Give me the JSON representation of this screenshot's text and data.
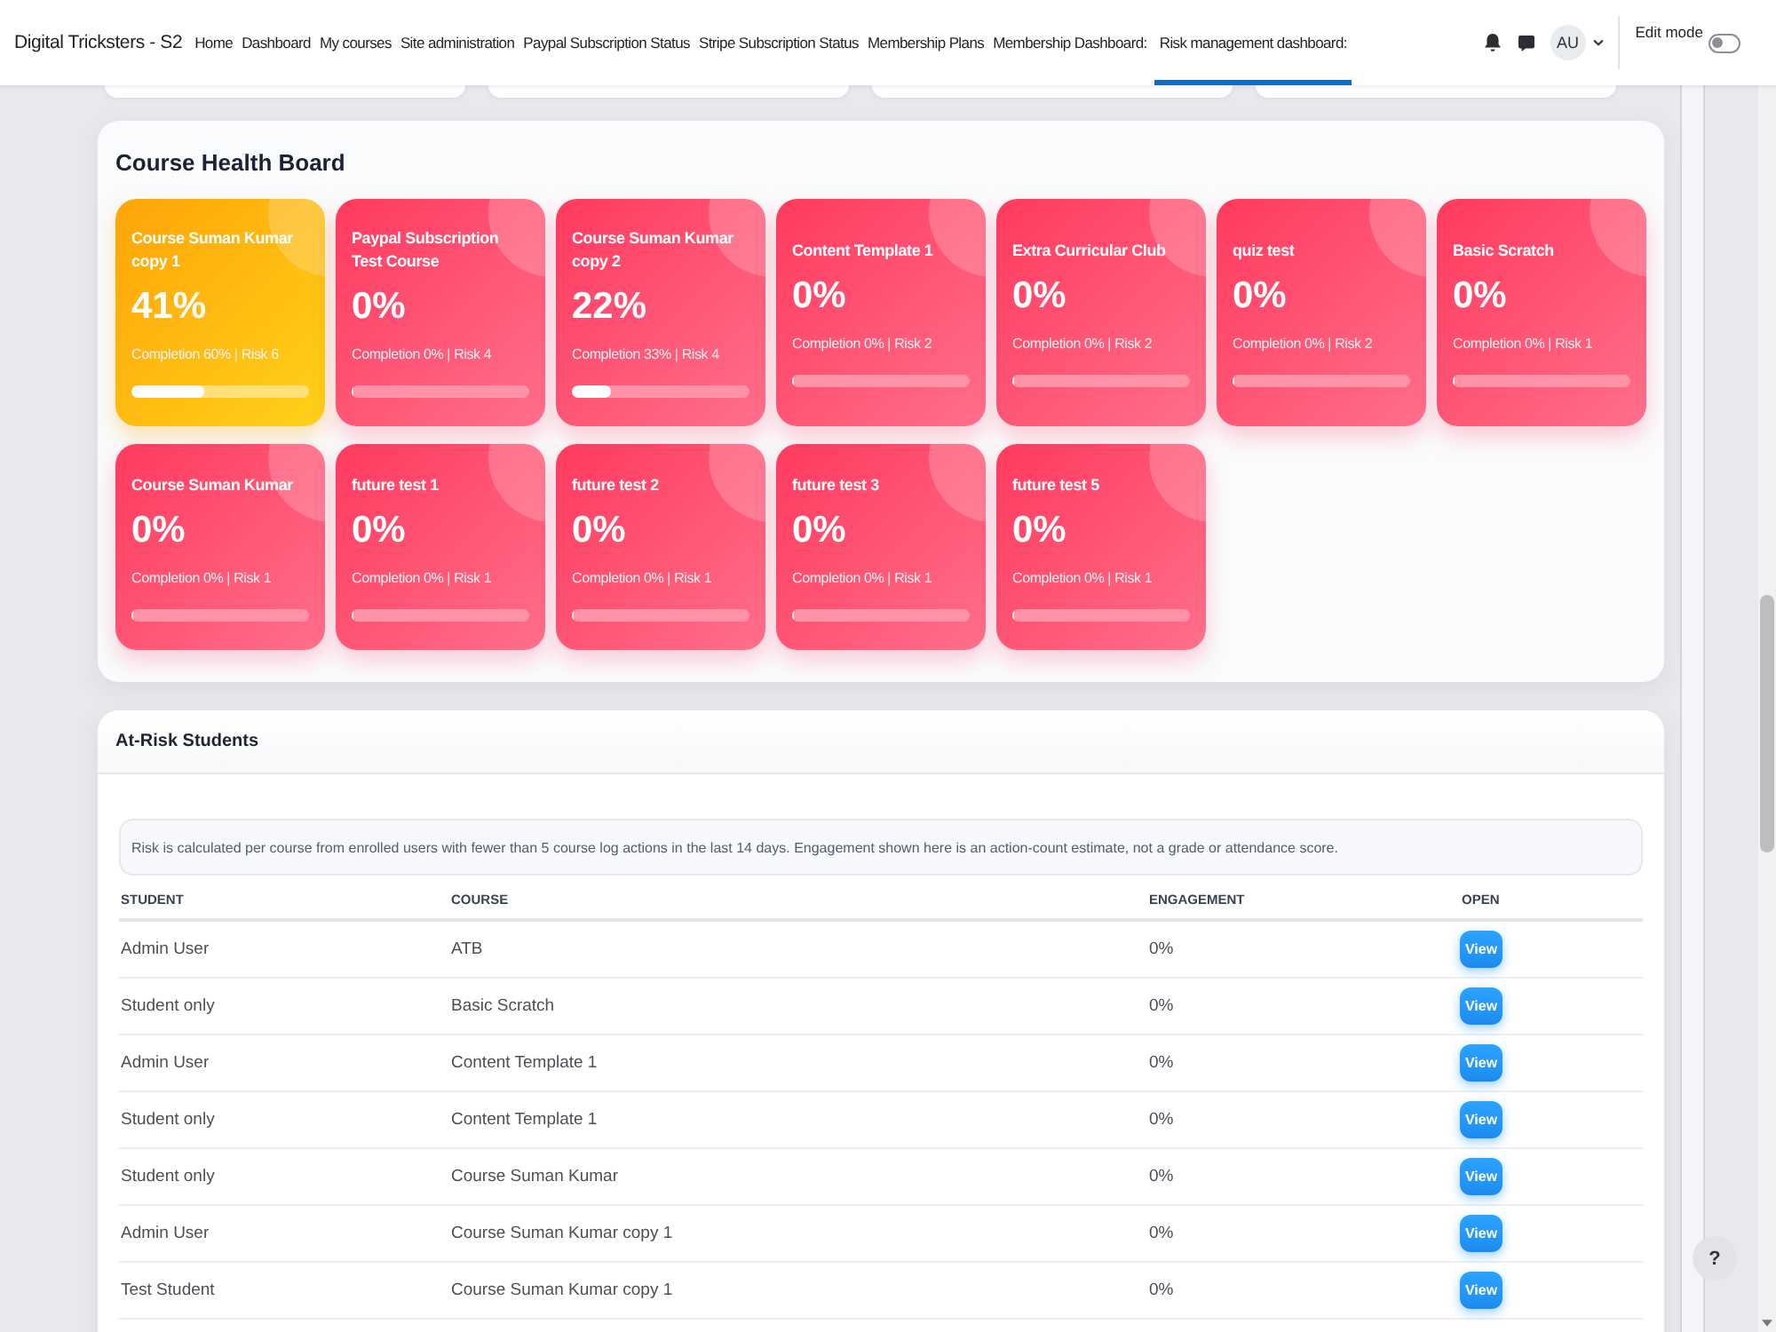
{
  "navbar": {
    "brand": "Digital Tricksters - S2",
    "items": [
      {
        "label": "Home",
        "selected": false
      },
      {
        "label": "Dashboard",
        "selected": false
      },
      {
        "label": "My courses",
        "selected": false
      },
      {
        "label": "Site administration",
        "selected": false
      },
      {
        "label": "Paypal Subscription Status",
        "selected": false
      },
      {
        "label": "Stripe Subscription Status",
        "selected": false
      },
      {
        "label": "Membership Plans",
        "selected": false
      },
      {
        "label": "Membership Dashboard:",
        "selected": false
      },
      {
        "label": "Risk management dashboard:",
        "selected": true
      }
    ],
    "avatar": "AU",
    "edit_mode": {
      "label": "Edit mode",
      "on": false
    }
  },
  "health_board": {
    "title": "Course Health Board",
    "courses": [
      {
        "name": "Course Suman Kumar copy 1",
        "percent": "41%",
        "detail": "Completion 60% | Risk 6",
        "level": 0.41,
        "critical": false
      },
      {
        "name": "Paypal Subscription Test Course",
        "percent": "0%",
        "detail": "Completion 0% | Risk 4",
        "level": 0,
        "critical": true
      },
      {
        "name": "Course Suman Kumar copy 2",
        "percent": "22%",
        "detail": "Completion 33% | Risk 4",
        "level": 0.22,
        "critical": true
      },
      {
        "name": "Content Template 1",
        "percent": "0%",
        "detail": "Completion 0% | Risk 2",
        "level": 0,
        "critical": true
      },
      {
        "name": "Extra Curricular Club",
        "percent": "0%",
        "detail": "Completion 0% | Risk 2",
        "level": 0,
        "critical": true
      },
      {
        "name": "quiz test",
        "percent": "0%",
        "detail": "Completion 0% | Risk 2",
        "level": 0,
        "critical": true
      },
      {
        "name": "Basic Scratch",
        "percent": "0%",
        "detail": "Completion 0% | Risk 1",
        "level": 0,
        "critical": true
      },
      {
        "name": "Course Suman Kumar",
        "percent": "0%",
        "detail": "Completion 0% | Risk 1",
        "level": 0,
        "critical": true
      },
      {
        "name": "future test 1",
        "percent": "0%",
        "detail": "Completion 0% | Risk 1",
        "level": 0,
        "critical": true
      },
      {
        "name": "future test 2",
        "percent": "0%",
        "detail": "Completion 0% | Risk 1",
        "level": 0,
        "critical": true
      },
      {
        "name": "future test 3",
        "percent": "0%",
        "detail": "Completion 0% | Risk 1",
        "level": 0,
        "critical": true
      },
      {
        "name": "future test 5",
        "percent": "0%",
        "detail": "Completion 0% | Risk 1",
        "level": 0,
        "critical": true
      }
    ]
  },
  "at_risk": {
    "title": "At-Risk Students",
    "note": "Risk is calculated per course from enrolled users with fewer than 5 course log actions in the last 14 days. Engagement shown here is an action-count estimate, not a grade or attendance score.",
    "columns": [
      "STUDENT",
      "COURSE",
      "ENGAGEMENT",
      "OPEN"
    ],
    "rows": [
      {
        "student": "Admin User",
        "course": "ATB",
        "engagement": "0%",
        "action": "View"
      },
      {
        "student": "Student only",
        "course": "Basic Scratch",
        "engagement": "0%",
        "action": "View"
      },
      {
        "student": "Admin User",
        "course": "Content Template 1",
        "engagement": "0%",
        "action": "View"
      },
      {
        "student": "Student only",
        "course": "Content Template 1",
        "engagement": "0%",
        "action": "View"
      },
      {
        "student": "Student only",
        "course": "Course Suman Kumar",
        "engagement": "0%",
        "action": "View"
      },
      {
        "student": "Admin User",
        "course": "Course Suman Kumar copy 1",
        "engagement": "0%",
        "action": "View"
      },
      {
        "student": "Test Student",
        "course": "Course Suman Kumar copy 1",
        "engagement": "0%",
        "action": "View"
      }
    ]
  },
  "help_button": "?"
}
